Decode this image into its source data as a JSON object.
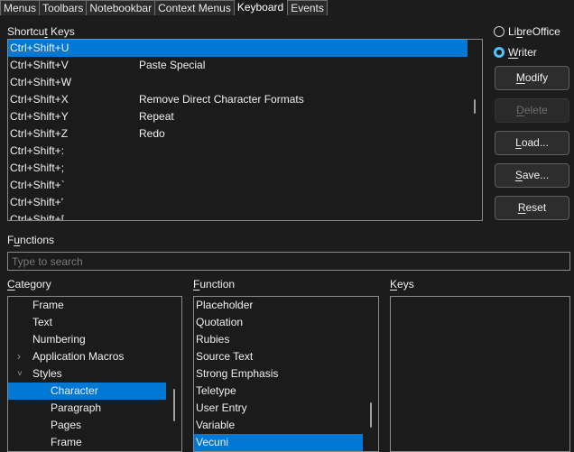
{
  "tabs": [
    {
      "label": "Menus",
      "active": false
    },
    {
      "label": "Toolbars",
      "active": false
    },
    {
      "label": "Notebookbar",
      "active": false
    },
    {
      "label": "Context Menus",
      "active": false
    },
    {
      "label": "Keyboard",
      "active": true
    },
    {
      "label": "Events",
      "active": false
    }
  ],
  "shortcut_keys": {
    "label": "Shortcut Keys",
    "rows": [
      {
        "key": "Ctrl+Shift+U",
        "function": "",
        "selected": true
      },
      {
        "key": "Ctrl+Shift+V",
        "function": "Paste Special"
      },
      {
        "key": "Ctrl+Shift+W",
        "function": ""
      },
      {
        "key": "Ctrl+Shift+X",
        "function": "Remove Direct Character Formats"
      },
      {
        "key": "Ctrl+Shift+Y",
        "function": "Repeat"
      },
      {
        "key": "Ctrl+Shift+Z",
        "function": "Redo"
      },
      {
        "key": "Ctrl+Shift+:",
        "function": ""
      },
      {
        "key": "Ctrl+Shift+;",
        "function": ""
      },
      {
        "key": "Ctrl+Shift+`",
        "function": ""
      },
      {
        "key": "Ctrl+Shift+'",
        "function": ""
      },
      {
        "key": "Ctrl+Shift+[",
        "function": ""
      }
    ]
  },
  "scope": {
    "options": [
      {
        "label": "LibreOffice",
        "checked": false
      },
      {
        "label": "Writer",
        "checked": true
      }
    ]
  },
  "buttons": {
    "modify": "Modify",
    "delete": "Delete",
    "load": "Load...",
    "save": "Save...",
    "reset": "Reset"
  },
  "functions": {
    "label": "Functions",
    "search_placeholder": "Type to search",
    "search_value": ""
  },
  "category": {
    "label": "Category",
    "items": [
      {
        "label": "Frame",
        "level": 1
      },
      {
        "label": "Text",
        "level": 1
      },
      {
        "label": "Numbering",
        "level": 1
      },
      {
        "label": "Application Macros",
        "level": 1,
        "expander": "collapsed"
      },
      {
        "label": "Styles",
        "level": 1,
        "expander": "expanded"
      },
      {
        "label": "Character",
        "level": 2,
        "selected": true
      },
      {
        "label": "Paragraph",
        "level": 2
      },
      {
        "label": "Pages",
        "level": 2
      },
      {
        "label": "Frame",
        "level": 2
      }
    ]
  },
  "function": {
    "label": "Function",
    "items": [
      {
        "label": "Placeholder"
      },
      {
        "label": "Quotation"
      },
      {
        "label": "Rubies"
      },
      {
        "label": "Source Text"
      },
      {
        "label": "Strong Emphasis"
      },
      {
        "label": "Teletype"
      },
      {
        "label": "User Entry"
      },
      {
        "label": "Variable"
      },
      {
        "label": "Vecuni",
        "selected": true
      }
    ]
  },
  "keys": {
    "label": "Keys",
    "items": []
  },
  "colors": {
    "selection": "#0078d4",
    "radio_accent": "#4cc2ff",
    "background": "#1c1c1c"
  }
}
